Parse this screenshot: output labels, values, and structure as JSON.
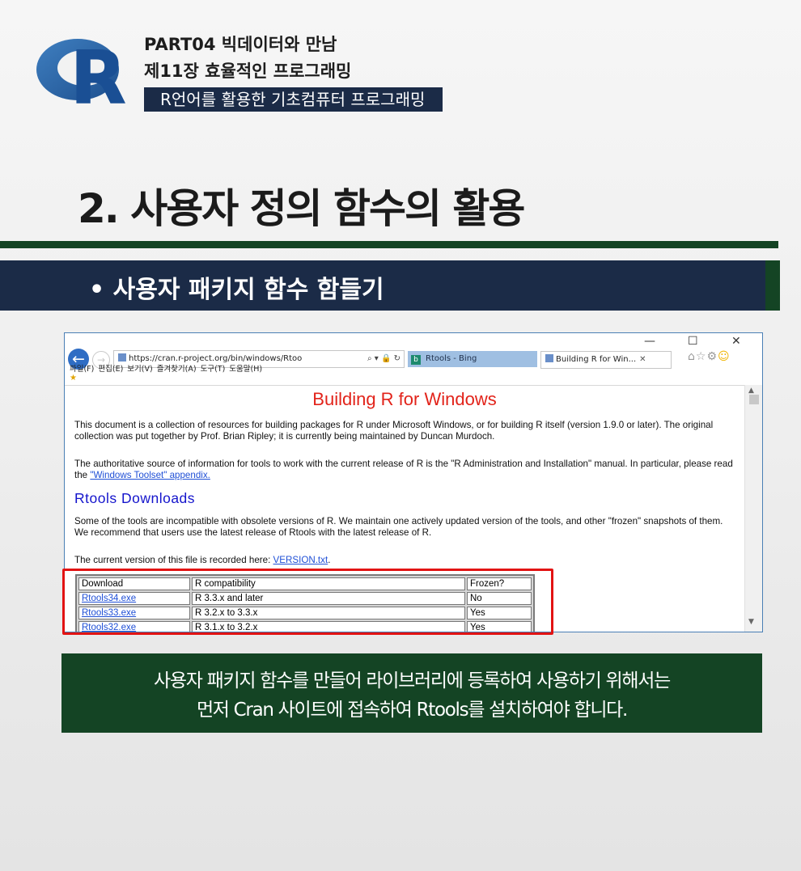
{
  "header": {
    "logo_letter": "R",
    "line1": "PART04 빅데이터와 만남",
    "line2": "제11장 효율적인 프로그래밍",
    "line3": "R언어를 활용한 기초컴퓨터 프로그래밍"
  },
  "slide": {
    "title": "2. 사용자 정의 함수의 활용",
    "bullet": "• 사용자 패키지 함수 함들기",
    "caption_line1": "사용자 패키지 함수를 만들어 라이브러리에 등록하여 사용하기 위해서는",
    "caption_line2": "먼저 Cran 사이트에 접속하여 Rtools를 설치하여야 합니다."
  },
  "browser": {
    "window_controls": {
      "minimize": "—",
      "maximize": "☐",
      "close": "✕"
    },
    "address": "https://cran.r-project.org/bin/windows/Rtoo",
    "address_tools": "⌕ ▾ 🔒 ↻",
    "tabs": [
      {
        "label": "Rtools - Bing",
        "icon": "b"
      },
      {
        "label": "Building R for Win...",
        "close": "✕"
      }
    ],
    "toolbar_icons": "⌂☆⚙",
    "toolbar_smiley": "☺",
    "menu": "파일(F) 편집(E) 보기(V) 즐겨찾기(A) 도구(T) 도움말(H)",
    "fav_star": "★",
    "page": {
      "title": "Building R for Windows",
      "p1": "This document is a collection of resources for building packages for R under Microsoft Windows, or for building R itself (version 1.9.0 or later). The original collection was put together by Prof. Brian Ripley; it is currently being maintained by Duncan Murdoch.",
      "p2_text": "The authoritative source of information for tools to work with the current release of R is the \"R Administration and Installation\" manual. In particular, please read the",
      "p2_link": "\"Windows Toolset\" appendix.",
      "subtitle": "Rtools Downloads",
      "p3": "Some of the tools are incompatible with obsolete versions of R. We maintain one actively updated version of the tools, and other \"frozen\" snapshots of them. We recommend that users use the latest release of Rtools with the latest release of R.",
      "p4_text": "The current version of this file is recorded here:",
      "p4_link": "VERSION.txt",
      "p4_end": ".",
      "table": {
        "headers": [
          "Download",
          "R compatibility",
          "Frozen?"
        ],
        "rows": [
          [
            "Rtools34.exe",
            "R 3.3.x and later",
            "No"
          ],
          [
            "Rtools33.exe",
            "R 3.2.x to 3.3.x",
            "Yes"
          ],
          [
            "Rtools32.exe",
            "R 3.1.x to 3.2.x",
            "Yes"
          ]
        ]
      }
    }
  }
}
